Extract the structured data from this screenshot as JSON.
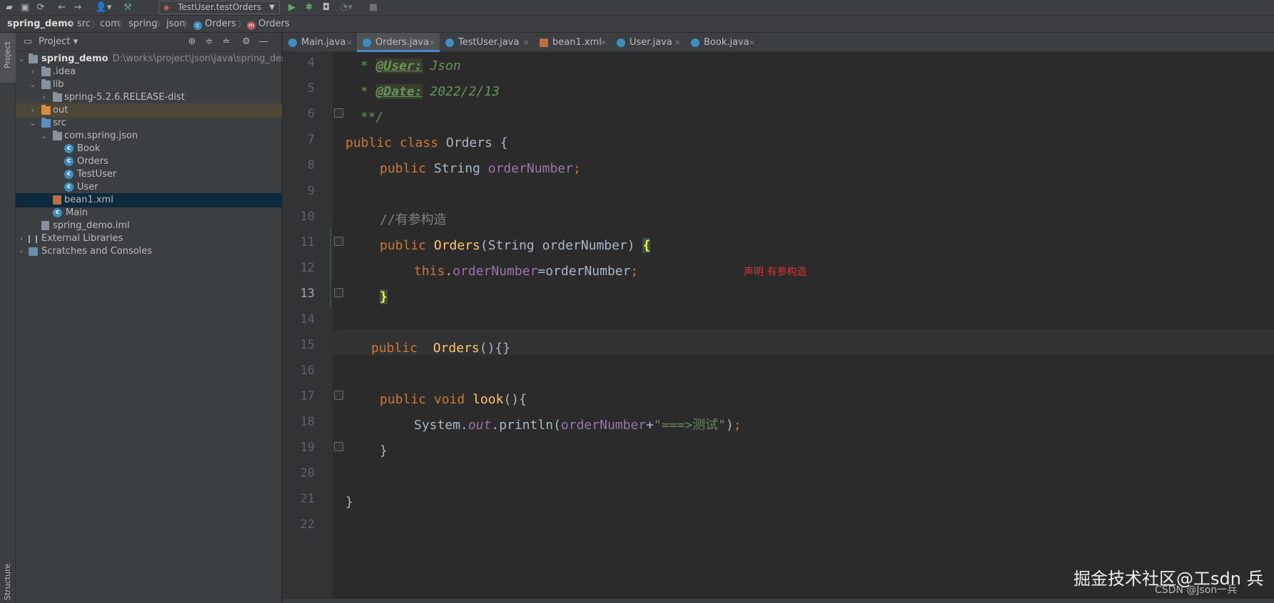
{
  "toolbar": {
    "run_config": "TestUser.testOrders",
    "icons": [
      "open-folder-icon",
      "save-icon",
      "sync-icon",
      "back-icon",
      "forward-icon",
      "user-icon",
      "build-hammer-icon",
      "run-icon",
      "debug-icon",
      "coverage-icon",
      "profile-icon",
      "stop-icon"
    ]
  },
  "breadcrumb": [
    {
      "label": "spring_demo",
      "type": "project"
    },
    {
      "label": "src"
    },
    {
      "label": "com"
    },
    {
      "label": "spring"
    },
    {
      "label": "json"
    },
    {
      "label": "Orders",
      "badge": "c",
      "badge_color": "#3d8ec0"
    },
    {
      "label": "Orders",
      "badge": "m",
      "badge_color": "#b95454"
    }
  ],
  "left_strip": {
    "top_tab": "Project",
    "bottom_tab": "Structure"
  },
  "project_panel": {
    "title": "Project",
    "tree": [
      {
        "label": "spring_demo",
        "path": "D:\\works\\project\\json\\java\\spring_demo",
        "arrow": "down",
        "icon": "folder"
      },
      {
        "label": ".idea",
        "arrow": "right",
        "icon": "folder"
      },
      {
        "label": "lib",
        "arrow": "down",
        "icon": "folder"
      },
      {
        "label": "spring-5.2.6.RELEASE-dist",
        "arrow": "right",
        "icon": "folder"
      },
      {
        "label": "out",
        "arrow": "right",
        "icon": "folder-orange"
      },
      {
        "label": "src",
        "arrow": "down",
        "icon": "folder-blue"
      },
      {
        "label": "com.spring.json",
        "arrow": "down",
        "icon": "folder"
      },
      {
        "label": "Book",
        "icon": "class"
      },
      {
        "label": "Orders",
        "icon": "class"
      },
      {
        "label": "TestUser",
        "icon": "class"
      },
      {
        "label": "User",
        "icon": "class"
      },
      {
        "label": "bean1.xml",
        "icon": "xml"
      },
      {
        "label": "Main",
        "icon": "class"
      },
      {
        "label": "spring_demo.iml",
        "icon": "iml"
      },
      {
        "label": "External Libraries",
        "arrow": "right",
        "icon": "library"
      },
      {
        "label": "Scratches and Consoles",
        "arrow": "right",
        "icon": "scratch"
      }
    ]
  },
  "tabs": [
    {
      "label": "Main.java",
      "icon": "class"
    },
    {
      "label": "Orders.java",
      "icon": "class",
      "active": true
    },
    {
      "label": "TestUser.java",
      "icon": "class"
    },
    {
      "label": "bean1.xml",
      "icon": "xml"
    },
    {
      "label": "User.java",
      "icon": "class"
    },
    {
      "label": "Book.java",
      "icon": "class"
    }
  ],
  "editor": {
    "line_numbers": [
      "4",
      "5",
      "6",
      "7",
      "8",
      "9",
      "10",
      "11",
      "12",
      "13",
      "14",
      "15",
      "16",
      "17",
      "18",
      "19",
      "20",
      "21",
      "22"
    ],
    "current_line": "13",
    "code": {
      "l4": {
        "star": " * ",
        "tag": "@User:",
        "text": " Json"
      },
      "l5": {
        "star": " * ",
        "tag": "@Date:",
        "text": " 2022/2/13"
      },
      "l6": {
        "text": " **/"
      },
      "l7": {
        "kw1": "public",
        "kw2": "class",
        "name": "Orders",
        "brace": "{"
      },
      "l8": {
        "kw": "public",
        "type": "String",
        "field": "orderNumber",
        "semi": ";"
      },
      "l10": {
        "comment": "//有参构造"
      },
      "l11": {
        "kw": "public",
        "name": "Orders",
        "params_open": "(String orderNumber) ",
        "brace": "{"
      },
      "l12": {
        "this": "this",
        "dot": ".",
        "field": "orderNumber",
        "rest": "=orderNumber",
        "semi": ";"
      },
      "l13": {
        "brace": "}"
      },
      "l15": {
        "kw": "public",
        "name": "Orders",
        "rest": "(){}"
      },
      "l17": {
        "kw1": "public",
        "kw2": "void",
        "name": "look",
        "rest": "(){"
      },
      "l18": {
        "sys": "System.",
        "out": "out",
        "call": ".println(",
        "field": "orderNumber",
        "plus": "+",
        "str": "\"===>测试\"",
        "end": ")",
        "semi": ";"
      },
      "l19": {
        "brace": "}"
      },
      "l21": {
        "brace": "}"
      }
    },
    "annotation": "声明 有参构造"
  },
  "watermark": {
    "main": "掘金技术社区@工sdn 兵",
    "sub": "CSDN @Json一兵"
  },
  "colors": {
    "keyword": "#cc7832",
    "field": "#9876aa",
    "string": "#6a8759",
    "comment": "#808080",
    "doc": "#629755",
    "selection": "#0d293e",
    "annotation": "#e0312b"
  }
}
